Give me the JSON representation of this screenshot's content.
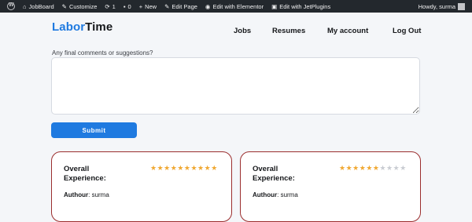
{
  "admin_bar": {
    "site_name": "JobBoard",
    "customize": "Customize",
    "updates_count": "1",
    "comments_count": "0",
    "new_label": "New",
    "edit_page": "Edit Page",
    "edit_elementor": "Edit with Elementor",
    "edit_jetplugins": "Edit with JetPlugins",
    "greeting": "Howdy, surma"
  },
  "site": {
    "logo_part1": "Labor",
    "logo_part2": "Time",
    "nav": [
      "Jobs",
      "Resumes",
      "My account",
      "Log Out"
    ]
  },
  "form": {
    "comment_label": "Any final comments or suggestions?",
    "comment_value": "",
    "submit_label": "Submit"
  },
  "reviews": [
    {
      "title_line1": "Overall",
      "title_line2": "Experience:",
      "rating": 10,
      "max": 10,
      "author_key": "Authour",
      "author": "surma"
    },
    {
      "title_line1": "Overall",
      "title_line2": "Experience:",
      "rating": 6,
      "max": 10,
      "author_key": "Authour",
      "author": "surma"
    }
  ],
  "colors": {
    "accent": "#1f7ae0",
    "admin_bar": "#23282d",
    "card_border": "#9b2d2d",
    "star_on": "#f0a832",
    "star_off": "#c9ccd2"
  }
}
